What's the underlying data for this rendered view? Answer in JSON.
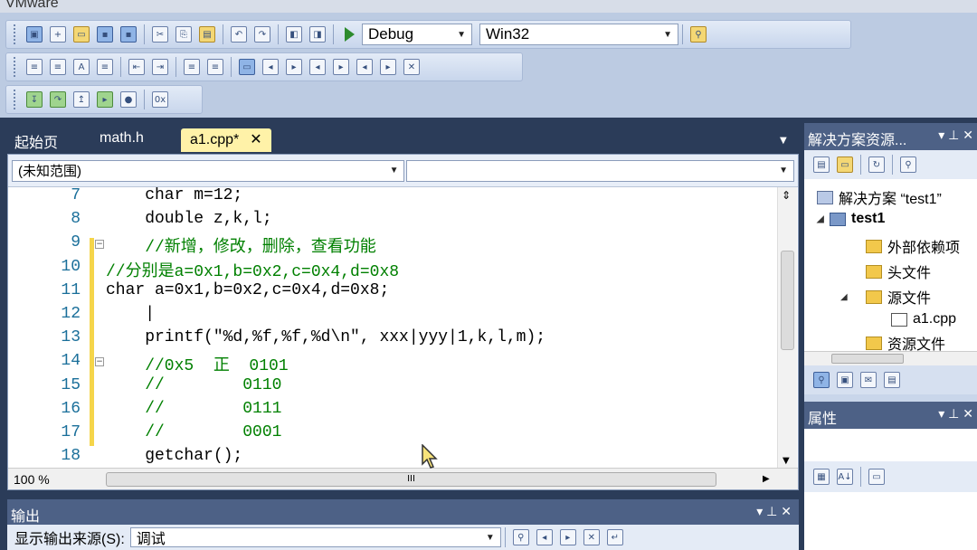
{
  "window": {
    "title": "VMware"
  },
  "toolbar": {
    "config_value": "Debug",
    "platform_value": "Win32"
  },
  "tabs": [
    {
      "label": "起始页"
    },
    {
      "label": "math.h"
    },
    {
      "label": "a1.cpp*",
      "active": true
    }
  ],
  "editor": {
    "scope_value": "(未知范围)",
    "member_value": "",
    "zoom": "100 %",
    "lines": [
      {
        "num": "7",
        "text": "    char m=12;"
      },
      {
        "num": "8",
        "text": "    double z,k,l;"
      },
      {
        "num": "9",
        "text": "    //新增，修改，删除，查看功能",
        "comment": true
      },
      {
        "num": "10",
        "text": "//分别是a=0x1,b=0x2,c=0x4,d=0x8",
        "comment": true
      },
      {
        "num": "11",
        "text": "char a=0x1,b=0x2,c=0x4,d=0x8;"
      },
      {
        "num": "12",
        "text": "    |"
      },
      {
        "num": "13",
        "text": "    printf(\"%d,%f,%f,%d\\n\", xxx|yyy|1,k,l,m);"
      },
      {
        "num": "14",
        "text": "    //0x5  正  0101",
        "comment": true
      },
      {
        "num": "15",
        "text": "    //        0110",
        "comment": true
      },
      {
        "num": "16",
        "text": "    //        0111",
        "comment": true
      },
      {
        "num": "17",
        "text": "    //        0001",
        "comment": true
      },
      {
        "num": "18",
        "text": "    getchar();"
      }
    ]
  },
  "solution_explorer": {
    "title": "解决方案资源...",
    "controls": "▾ ⊥ ✕",
    "items": [
      {
        "label": "解决方案 “test1”",
        "icon": "solution-icon"
      },
      {
        "label": "test1",
        "icon": "project-icon",
        "bold": true
      },
      {
        "label": "外部依赖项",
        "icon": "folder-icon"
      },
      {
        "label": "头文件",
        "icon": "folder-icon"
      },
      {
        "label": "源文件",
        "icon": "folder-icon"
      },
      {
        "label": "a1.cpp",
        "icon": "cpp-file-icon"
      },
      {
        "label": "资源文件",
        "icon": "folder-icon"
      }
    ]
  },
  "properties": {
    "title": "属性",
    "controls": "▾ ⊥ ✕"
  },
  "output": {
    "title": "输出",
    "controls": "▾ ⊥ ✕",
    "source_label": "显示输出来源(S):",
    "source_value": "调试"
  }
}
